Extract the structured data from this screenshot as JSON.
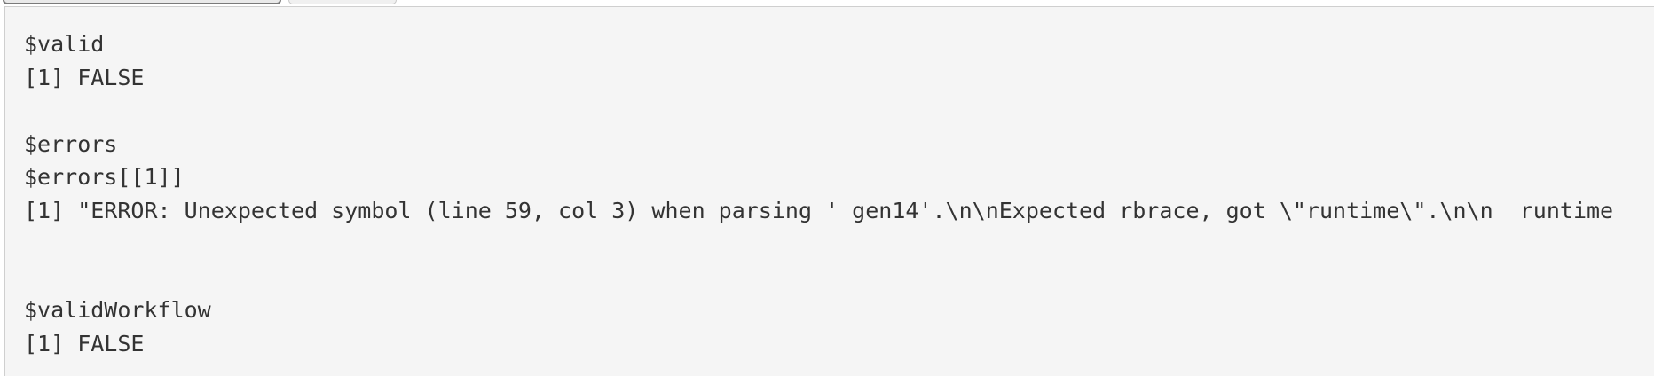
{
  "console": {
    "lines": [
      "$valid",
      "[1] FALSE",
      "",
      "$errors",
      "$errors[[1]]",
      "[1] \"ERROR: Unexpected symbol (line 59, col 3) when parsing '_gen14'.\\n\\nExpected rbrace, got \\\"runtime\\\".\\n\\n  runtime",
      "",
      "",
      "$validWorkflow",
      "[1] FALSE"
    ]
  },
  "colors": {
    "background": "#f5f5f5",
    "text": "#333333"
  }
}
